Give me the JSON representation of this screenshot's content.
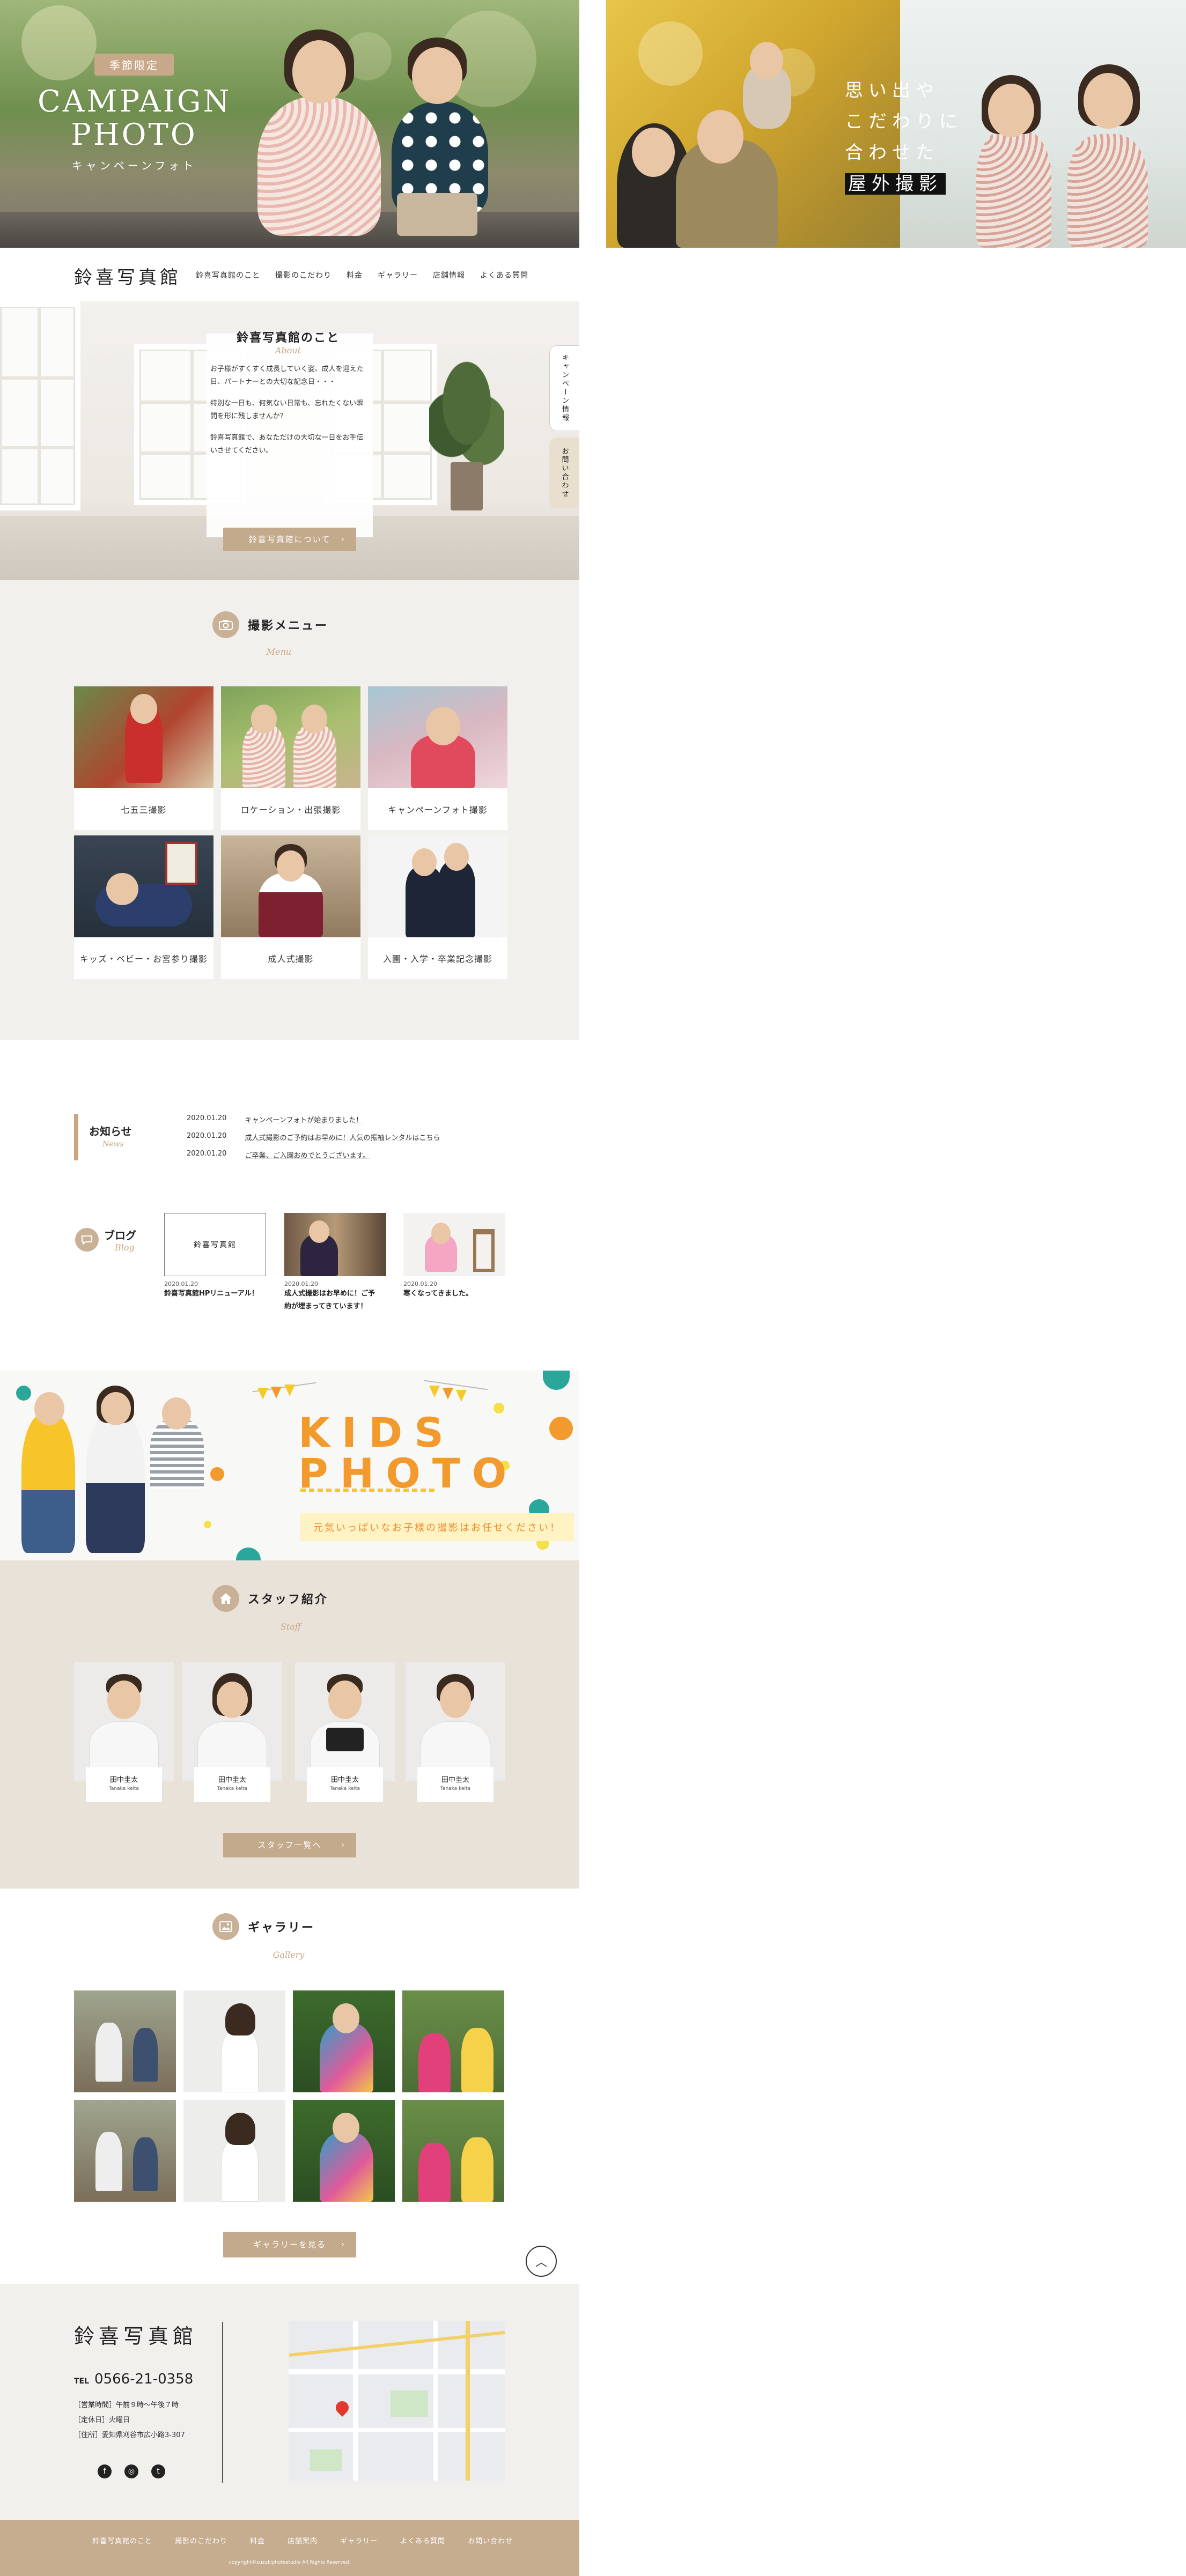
{
  "hero": {
    "campaign_badge": "季節限定",
    "campaign_title": "CAMPAIGN PHOTO",
    "campaign_sub": "キャンペーンフォト",
    "outdoor_copy_lines": [
      "思い出や",
      "こだわりに",
      "合わせた"
    ],
    "outdoor_copy_highlight": "屋外撮影"
  },
  "header": {
    "logo": "鈴喜写真館",
    "nav": [
      "鈴喜写真館のこと",
      "撮影のこだわり",
      "料金",
      "ギャラリー",
      "店舗情報",
      "よくある質問"
    ]
  },
  "about": {
    "title": "鈴喜写真館のこと",
    "subtitle": "About",
    "paragraphs": [
      "お子様がすくすく成長していく姿、成人を迎えた日、パートナーとの大切な記念日・・・",
      "特別な一日も、何気ない日常も、忘れたくない瞬間を形に残しませんか？",
      "鈴喜写真館で、あなただけの大切な一日をお手伝いさせてください。"
    ],
    "button": "鈴喜写真館について",
    "side_tabs": [
      "キャンペーン情報",
      "お問い合わせ"
    ]
  },
  "menu": {
    "title": "撮影メニュー",
    "subtitle": "Menu",
    "items": [
      {
        "label": "七五三撮影"
      },
      {
        "label": "ロケーション・出張撮影"
      },
      {
        "label": "キャンペーンフォト撮影"
      },
      {
        "label": "キッズ・ベビー・お宮参り撮影"
      },
      {
        "label": "成人式撮影"
      },
      {
        "label": "入園・入学・卒業記念撮影"
      }
    ]
  },
  "news": {
    "title": "お知らせ",
    "subtitle": "News",
    "items": [
      {
        "date": "2020.01.20",
        "text": "キャンペーンフォトが始まりました！"
      },
      {
        "date": "2020.01.20",
        "text": "成人式撮影のご予約はお早めに！人気の振袖レンタルはこちら"
      },
      {
        "date": "2020.01.20",
        "text": "ご卒業、ご入園おめでとうございます。"
      }
    ]
  },
  "blog": {
    "title": "ブログ",
    "subtitle": "Blog",
    "items": [
      {
        "date": "2020.01.20",
        "title_lines": [
          "鈴喜写真館HPリニューアル！"
        ],
        "thumb_text": "鈴喜写真館"
      },
      {
        "date": "2020.01.20",
        "title_lines": [
          "成人式撮影はお早めに！ご予",
          "約が埋まってきています！"
        ]
      },
      {
        "date": "2020.01.20",
        "title_lines": [
          "寒くなってきました。"
        ]
      }
    ]
  },
  "kids": {
    "title_lines": [
      "KIDS",
      "PHOTO"
    ],
    "strip": "元気いっぱいなお子様の撮影はお任せください！"
  },
  "staff": {
    "title": "スタッフ紹介",
    "subtitle": "Staff",
    "members": [
      {
        "name": "田中圭太",
        "roman": "Tanaka keita"
      },
      {
        "name": "田中圭太",
        "roman": "Tanaka keita"
      },
      {
        "name": "田中圭太",
        "roman": "Tanaka keita"
      },
      {
        "name": "田中圭太",
        "roman": "Tanaka keita"
      }
    ],
    "button": "スタッフ一覧へ"
  },
  "gallery": {
    "title": "ギャラリー",
    "subtitle": "Gallery",
    "button": "ギャラリーを見る"
  },
  "footer": {
    "logo": "鈴喜写真館",
    "tel_label": "TEL",
    "tel": "0566-21-0358",
    "info": [
      "［営業時間］午前９時〜午後７時",
      "［定休日］火曜日",
      "［住所］愛知県刈谷市広小路3-307"
    ],
    "nav": [
      "鈴喜写真館のこと",
      "撮影のこだわり",
      "料金",
      "店舗案内",
      "ギャラリー",
      "よくある質問",
      "お問い合わせ"
    ],
    "copyright": "copyright©suzukiphotostudio All Rights Reserved."
  },
  "colors": {
    "accent": "#c4aa8c",
    "kids_orange": "#f39a2e",
    "kids_teal": "#2aa69a",
    "staff_bg": "#e9e2d9"
  }
}
